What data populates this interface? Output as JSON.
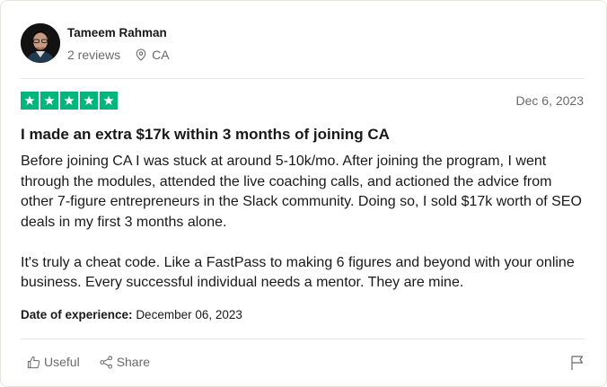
{
  "reviewer": {
    "name": "Tameem Rahman",
    "reviews_count": "2 reviews",
    "location": "CA"
  },
  "review": {
    "rating": 5,
    "star_color": "#00b67a",
    "date": "Dec 6, 2023",
    "title": "I made an extra $17k within 3 months of joining CA",
    "paragraph_1": "Before joining CA I was stuck at around 5-10k/mo. After joining the program, I went through the modules, attended the live coaching calls, and actioned the advice from other 7-figure entrepreneurs in the Slack community. Doing so, I sold $17k worth of SEO deals in my first 3 months alone.",
    "paragraph_2": "It's truly a cheat code. Like a FastPass to making 6 figures and beyond with your online business. Every successful individual needs a mentor. They are mine.",
    "experience_label": "Date of experience:",
    "experience_date": "December 06, 2023"
  },
  "actions": {
    "useful_label": "Useful",
    "share_label": "Share",
    "useful_icon": "thumbs-up-icon",
    "share_icon": "share-icon",
    "flag_icon": "flag-icon"
  }
}
